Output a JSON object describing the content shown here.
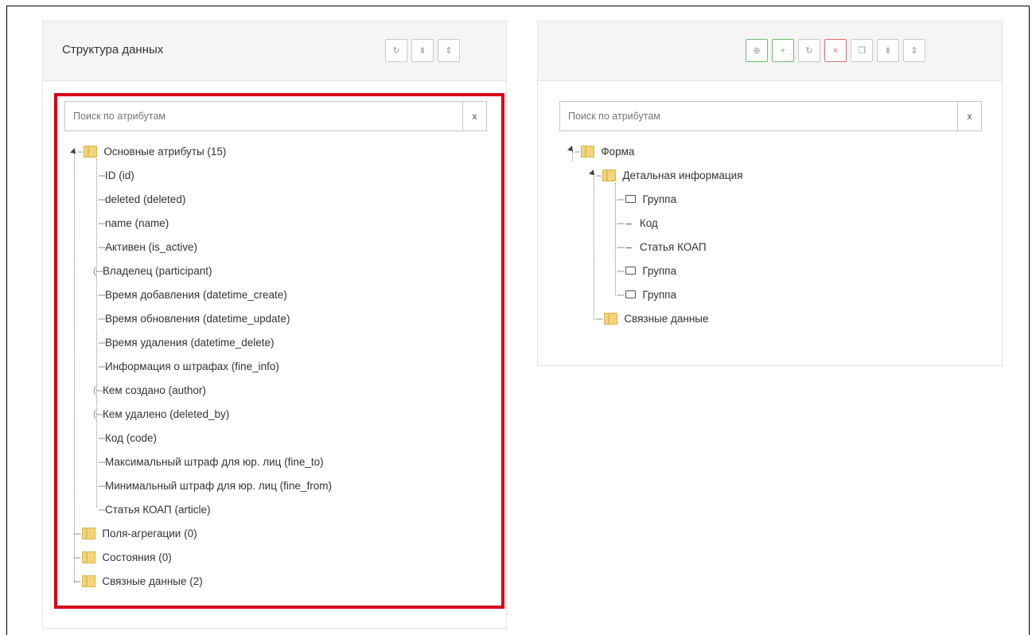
{
  "left_panel": {
    "title": "Структура данных",
    "toolbar": [
      {
        "name": "refresh-icon",
        "glyph": "↻"
      },
      {
        "name": "collapse-all-icon",
        "glyph": "⇟"
      },
      {
        "name": "expand-all-icon",
        "glyph": "⇕"
      }
    ],
    "search": {
      "placeholder": "Поиск по атрибутам",
      "value": "",
      "clear_label": "x"
    },
    "tree": {
      "root": "Основные атрибуты (15)",
      "attributes": [
        "ID (id)",
        "deleted (deleted)",
        "name (name)",
        "Активен (is_active)",
        "Владелец (participant)",
        "Время добавления (datetime_create)",
        "Время обновления (datetime_update)",
        "Время удаления (datetime_delete)",
        "Информация о штрафах (fine_info)",
        "Кем создано (author)",
        "Кем удалено (deleted_by)",
        "Код (code)",
        "Максимальный штраф для юр. лиц (fine_to)",
        "Минимальный штраф для юр. лиц (fine_from)",
        "Статья КОАП (article)"
      ],
      "other_folders": [
        "Поля-агрегации (0)",
        "Состояния (0)",
        "Связные данные (2)"
      ]
    }
  },
  "right_panel": {
    "toolbar": [
      {
        "name": "add-circle-icon",
        "glyph": "⊕",
        "style": "green"
      },
      {
        "name": "plus-icon",
        "glyph": "+",
        "style": "green"
      },
      {
        "name": "refresh-icon",
        "glyph": "↻",
        "style": "default"
      },
      {
        "name": "delete-icon",
        "glyph": "×",
        "style": "red"
      },
      {
        "name": "copy-icon",
        "glyph": "❐",
        "style": "default"
      },
      {
        "name": "collapse-all-icon",
        "glyph": "⇟",
        "style": "default"
      },
      {
        "name": "expand-all-icon",
        "glyph": "⇕",
        "style": "default"
      }
    ],
    "search": {
      "placeholder": "Поиск по атрибутам",
      "value": "",
      "clear_label": "x"
    },
    "tree": {
      "root": "Форма",
      "detail": "Детальная информация",
      "children": [
        {
          "type": "group",
          "label": "Группа"
        },
        {
          "type": "field",
          "label": "Код"
        },
        {
          "type": "field",
          "label": "Статья КОАП"
        },
        {
          "type": "group",
          "label": "Группа"
        },
        {
          "type": "group",
          "label": "Группа"
        }
      ],
      "related": "Связные данные"
    }
  },
  "highlight_color": "#d9001b"
}
